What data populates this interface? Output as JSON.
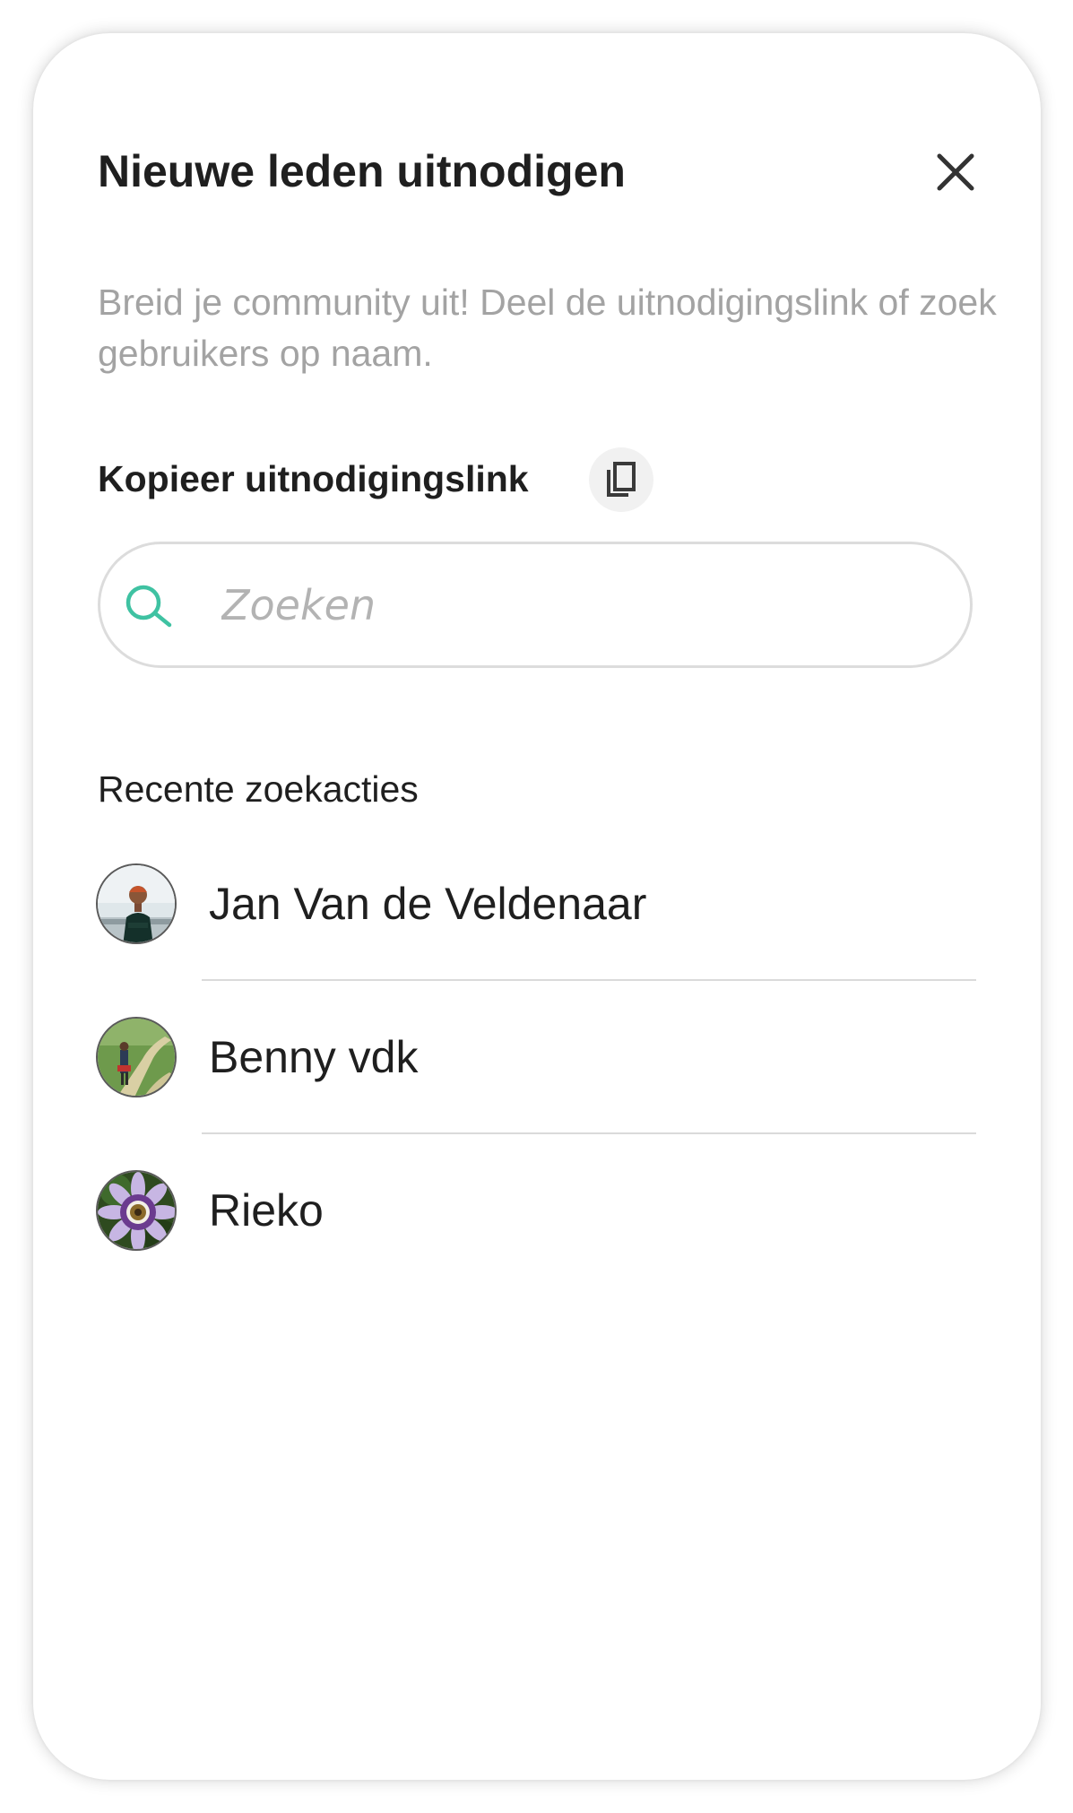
{
  "dialog": {
    "title": "Nieuwe leden uitnodigen",
    "close_icon": "close-icon",
    "description": "Breid je community uit! Deel de uitnodigingslink of zoek gebruikers op naam."
  },
  "invite_link": {
    "label": "Kopieer uitnodigingslink",
    "icon": "copy-icon"
  },
  "search": {
    "placeholder": "Zoeken",
    "value": "",
    "icon": "search-icon",
    "accent_color": "#3fc2a2"
  },
  "recent": {
    "heading": "Recente zoekacties",
    "items": [
      {
        "name": "Jan Van de Veldenaar",
        "avatar": "avatar-man-portrait"
      },
      {
        "name": "Benny vdk",
        "avatar": "avatar-person-on-path"
      },
      {
        "name": "Rieko",
        "avatar": "avatar-passion-flower"
      }
    ]
  },
  "colors": {
    "text_primary": "#1f1f1f",
    "text_secondary": "#a3a3a3",
    "divider": "#dadada",
    "copy_button_bg": "#f1f1f1"
  }
}
